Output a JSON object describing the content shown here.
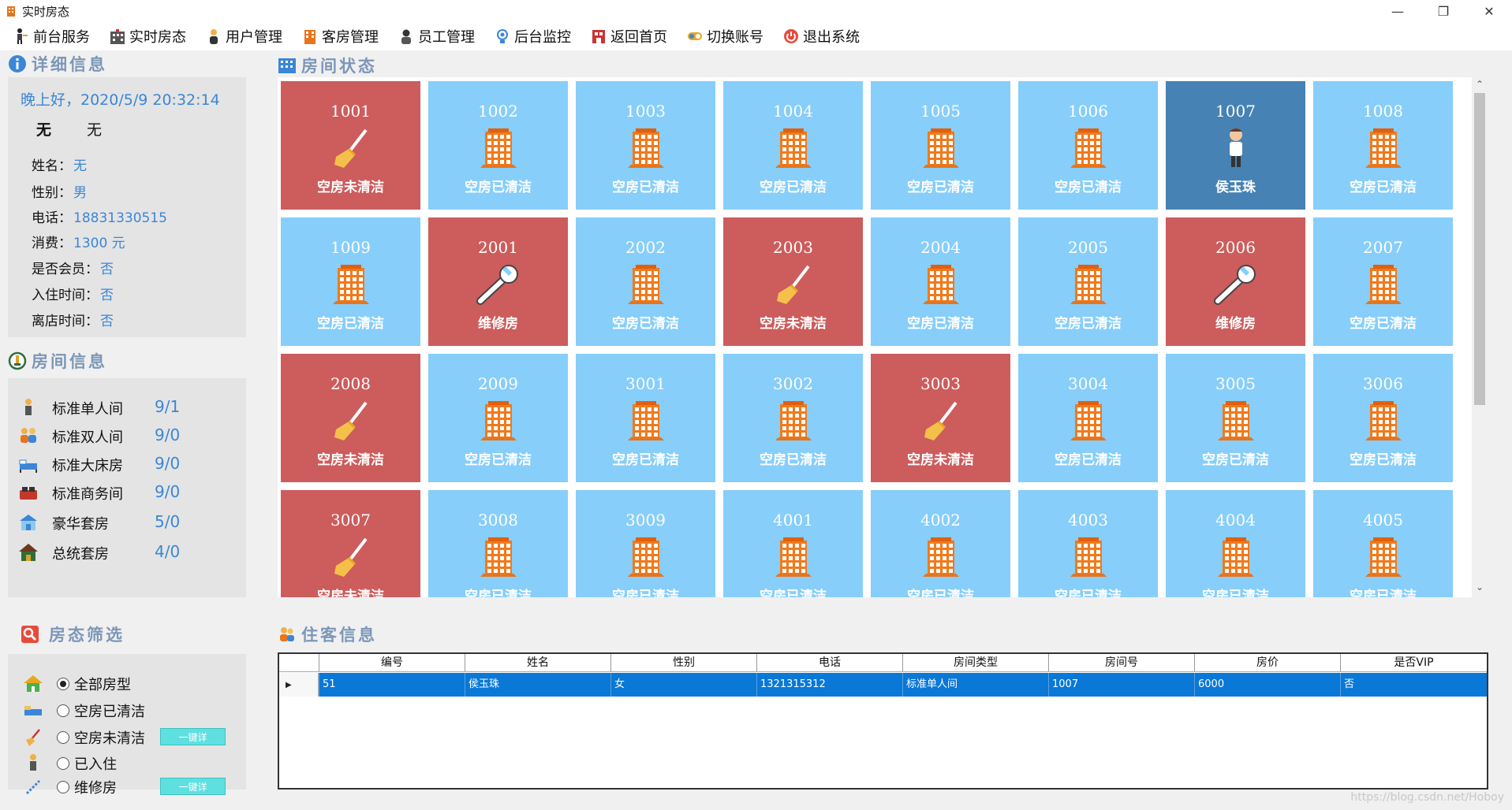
{
  "window": {
    "title": "实时房态"
  },
  "menu": [
    {
      "label": "前台服务",
      "icon": "front-desk-icon"
    },
    {
      "label": "实时房态",
      "icon": "hotel-icon"
    },
    {
      "label": "用户管理",
      "icon": "user-icon"
    },
    {
      "label": "客房管理",
      "icon": "room-icon"
    },
    {
      "label": "员工管理",
      "icon": "staff-icon"
    },
    {
      "label": "后台监控",
      "icon": "monitor-icon"
    },
    {
      "label": "返回首页",
      "icon": "home-icon"
    },
    {
      "label": "切换账号",
      "icon": "switch-icon"
    },
    {
      "label": "退出系统",
      "icon": "power-icon"
    }
  ],
  "detail": {
    "header": "详细信息",
    "greeting": "晚上好，2020/5/9 20:32:14",
    "none_a": "无",
    "none_b": "无",
    "fields": [
      {
        "label": "姓名：",
        "value": "无"
      },
      {
        "label": "性别：",
        "value": "男"
      },
      {
        "label": "电话：",
        "value": "18831330515"
      },
      {
        "label": "消费：",
        "value": "1300 元"
      },
      {
        "label": "是否会员：",
        "value": "否"
      },
      {
        "label": "入住时间：",
        "value": "否"
      },
      {
        "label": "离店时间：",
        "value": "否"
      }
    ]
  },
  "room_info": {
    "header": "房间信息",
    "types": [
      {
        "label": "标准单人间",
        "count": "9/1"
      },
      {
        "label": "标准双人间",
        "count": "9/0"
      },
      {
        "label": "标准大床房",
        "count": "9/0"
      },
      {
        "label": "标准商务间",
        "count": "9/0"
      },
      {
        "label": "豪华套房",
        "count": "5/0"
      },
      {
        "label": "总统套房",
        "count": "4/0"
      }
    ]
  },
  "filter": {
    "header": "房态筛选",
    "options": [
      {
        "label": "全部房型",
        "selected": true
      },
      {
        "label": "空房已清洁",
        "selected": false
      },
      {
        "label": "空房未清洁",
        "selected": false
      },
      {
        "label": "已入住",
        "selected": false
      },
      {
        "label": "维修房",
        "selected": false
      }
    ],
    "onekey_label": "一键详"
  },
  "room_status": {
    "header": "房间状态",
    "colors": {
      "dirty": "#cd5c5c",
      "clean": "#87cefa",
      "occupied": "#4682b4",
      "repair": "#cd5c5c"
    },
    "rooms": [
      {
        "num": "1001",
        "state": "dirty",
        "label": "空房未清洁"
      },
      {
        "num": "1002",
        "state": "clean",
        "label": "空房已清洁"
      },
      {
        "num": "1003",
        "state": "clean",
        "label": "空房已清洁"
      },
      {
        "num": "1004",
        "state": "clean",
        "label": "空房已清洁"
      },
      {
        "num": "1005",
        "state": "clean",
        "label": "空房已清洁"
      },
      {
        "num": "1006",
        "state": "clean",
        "label": "空房已清洁"
      },
      {
        "num": "1007",
        "state": "occupied",
        "label": "侯玉珠"
      },
      {
        "num": "1008",
        "state": "clean",
        "label": "空房已清洁"
      },
      {
        "num": "1009",
        "state": "clean",
        "label": "空房已清洁"
      },
      {
        "num": "2001",
        "state": "repair",
        "label": "维修房"
      },
      {
        "num": "2002",
        "state": "clean",
        "label": "空房已清洁"
      },
      {
        "num": "2003",
        "state": "dirty",
        "label": "空房未清洁"
      },
      {
        "num": "2004",
        "state": "clean",
        "label": "空房已清洁"
      },
      {
        "num": "2005",
        "state": "clean",
        "label": "空房已清洁"
      },
      {
        "num": "2006",
        "state": "repair",
        "label": "维修房"
      },
      {
        "num": "2007",
        "state": "clean",
        "label": "空房已清洁"
      },
      {
        "num": "2008",
        "state": "dirty",
        "label": "空房未清洁"
      },
      {
        "num": "2009",
        "state": "clean",
        "label": "空房已清洁"
      },
      {
        "num": "3001",
        "state": "clean",
        "label": "空房已清洁"
      },
      {
        "num": "3002",
        "state": "clean",
        "label": "空房已清洁"
      },
      {
        "num": "3003",
        "state": "dirty",
        "label": "空房未清洁"
      },
      {
        "num": "3004",
        "state": "clean",
        "label": "空房已清洁"
      },
      {
        "num": "3005",
        "state": "clean",
        "label": "空房已清洁"
      },
      {
        "num": "3006",
        "state": "clean",
        "label": "空房已清洁"
      },
      {
        "num": "3007",
        "state": "dirty",
        "label": "空房未清洁"
      },
      {
        "num": "3008",
        "state": "clean",
        "label": "空房已清洁"
      },
      {
        "num": "3009",
        "state": "clean",
        "label": "空房已清洁"
      },
      {
        "num": "4001",
        "state": "clean",
        "label": "空房已清洁"
      },
      {
        "num": "4002",
        "state": "clean",
        "label": "空房已清洁"
      },
      {
        "num": "4003",
        "state": "clean",
        "label": "空房已清洁"
      },
      {
        "num": "4004",
        "state": "clean",
        "label": "空房已清洁"
      },
      {
        "num": "4005",
        "state": "clean",
        "label": "空房已清洁"
      }
    ]
  },
  "guest": {
    "header": "住客信息",
    "columns": [
      "编号",
      "姓名",
      "性别",
      "电话",
      "房间类型",
      "房间号",
      "房价",
      "是否VIP"
    ],
    "rows": [
      [
        "51",
        "侯玉珠",
        "女",
        "1321315312",
        "标准单人间",
        "1007",
        "6000",
        "否"
      ]
    ]
  },
  "watermark": "https://blog.csdn.net/Hoboy"
}
